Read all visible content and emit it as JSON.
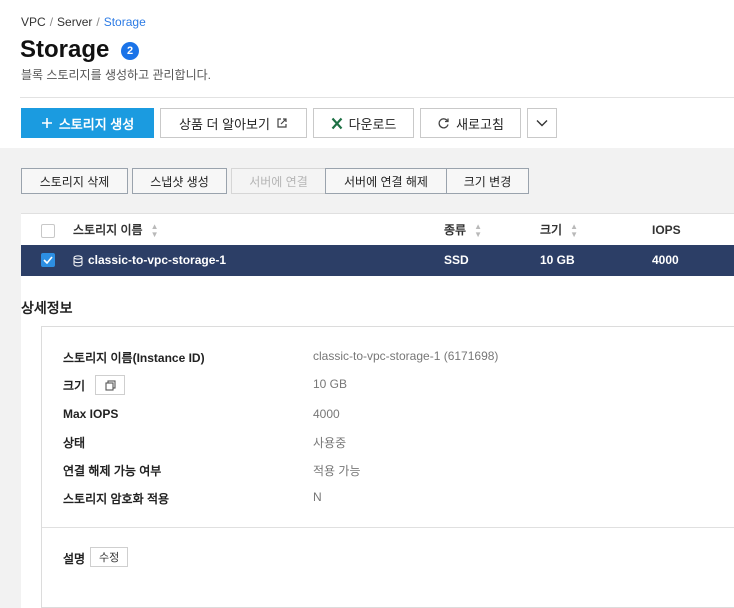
{
  "breadcrumb": {
    "items": [
      "VPC",
      "Server",
      "Storage"
    ],
    "separator": "/"
  },
  "page": {
    "title": "Storage",
    "count": "2",
    "subtitle": "블록 스토리지를 생성하고 관리합니다."
  },
  "toolbar": {
    "create_label": "스토리지 생성",
    "learn_more_label": "상품 더 알아보기",
    "download_label": "다운로드",
    "refresh_label": "새로고침"
  },
  "actions": {
    "delete_label": "스토리지 삭제",
    "snapshot_label": "스냅샷 생성",
    "attach_label": "서버에 연결",
    "detach_label": "서버에 연결 해제",
    "resize_label": "크기 변경"
  },
  "table": {
    "columns": [
      "스토리지 이름",
      "종류",
      "크기",
      "IOPS"
    ],
    "rows": [
      {
        "name": "classic-to-vpc-storage-1",
        "type": "SSD",
        "size": "10 GB",
        "iops": "4000",
        "selected": true
      }
    ]
  },
  "detail": {
    "title": "상세정보",
    "fields": [
      {
        "label": "스토리지 이름(Instance ID)",
        "value": "classic-to-vpc-storage-1 (6171698)"
      },
      {
        "label": "크기",
        "value": "10 GB"
      },
      {
        "label": "Max IOPS",
        "value": "4000"
      },
      {
        "label": "상태",
        "value": "사용중"
      },
      {
        "label": "연결 해제 가능 여부",
        "value": "적용 가능"
      },
      {
        "label": "스토리지 암호화 적용",
        "value": "N"
      }
    ],
    "description_label": "설명",
    "edit_label": "수정"
  },
  "colors": {
    "primary": "#1b9be0",
    "selected_row": "#2c3e66",
    "link": "#2c7be5",
    "badge": "#1a73e8",
    "excel_green": "#1e7145"
  }
}
